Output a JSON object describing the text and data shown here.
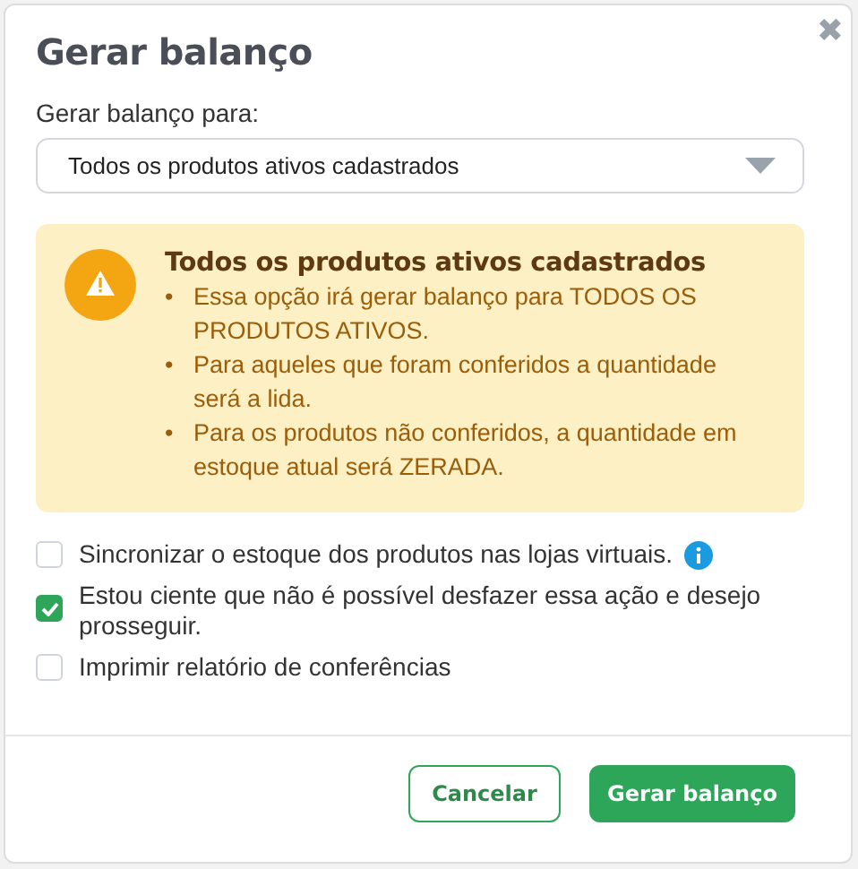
{
  "dialog": {
    "title": "Gerar balanço",
    "close": "✖"
  },
  "select": {
    "label": "Gerar balanço para:",
    "value": "Todos os produtos ativos cadastrados"
  },
  "warning": {
    "title": "Todos os produtos ativos cadastrados",
    "items": [
      {
        "marker": "•",
        "text": "Essa opção irá gerar balanço para TODOS OS PRODUTOS ATIVOS."
      },
      {
        "marker": "•",
        "text": "Para aqueles que foram conferidos a quantidade será a lida."
      },
      {
        "marker": "•",
        "text": "Para os produtos não conferidos, a quantidade em estoque atual será ZERADA."
      }
    ]
  },
  "options": [
    {
      "label": "Sincronizar o estoque dos produtos nas lojas virtuais.",
      "checked": false,
      "info": true
    },
    {
      "label": "Estou ciente que não é possível desfazer essa ação e desejo prosseguir.",
      "checked": true,
      "info": false
    },
    {
      "label": "Imprimir relatório de conferências",
      "checked": false,
      "info": false
    }
  ],
  "buttons": [
    {
      "label": "Cancelar",
      "kind": "secondary"
    },
    {
      "label": "Gerar balanço",
      "kind": "primary"
    }
  ]
}
